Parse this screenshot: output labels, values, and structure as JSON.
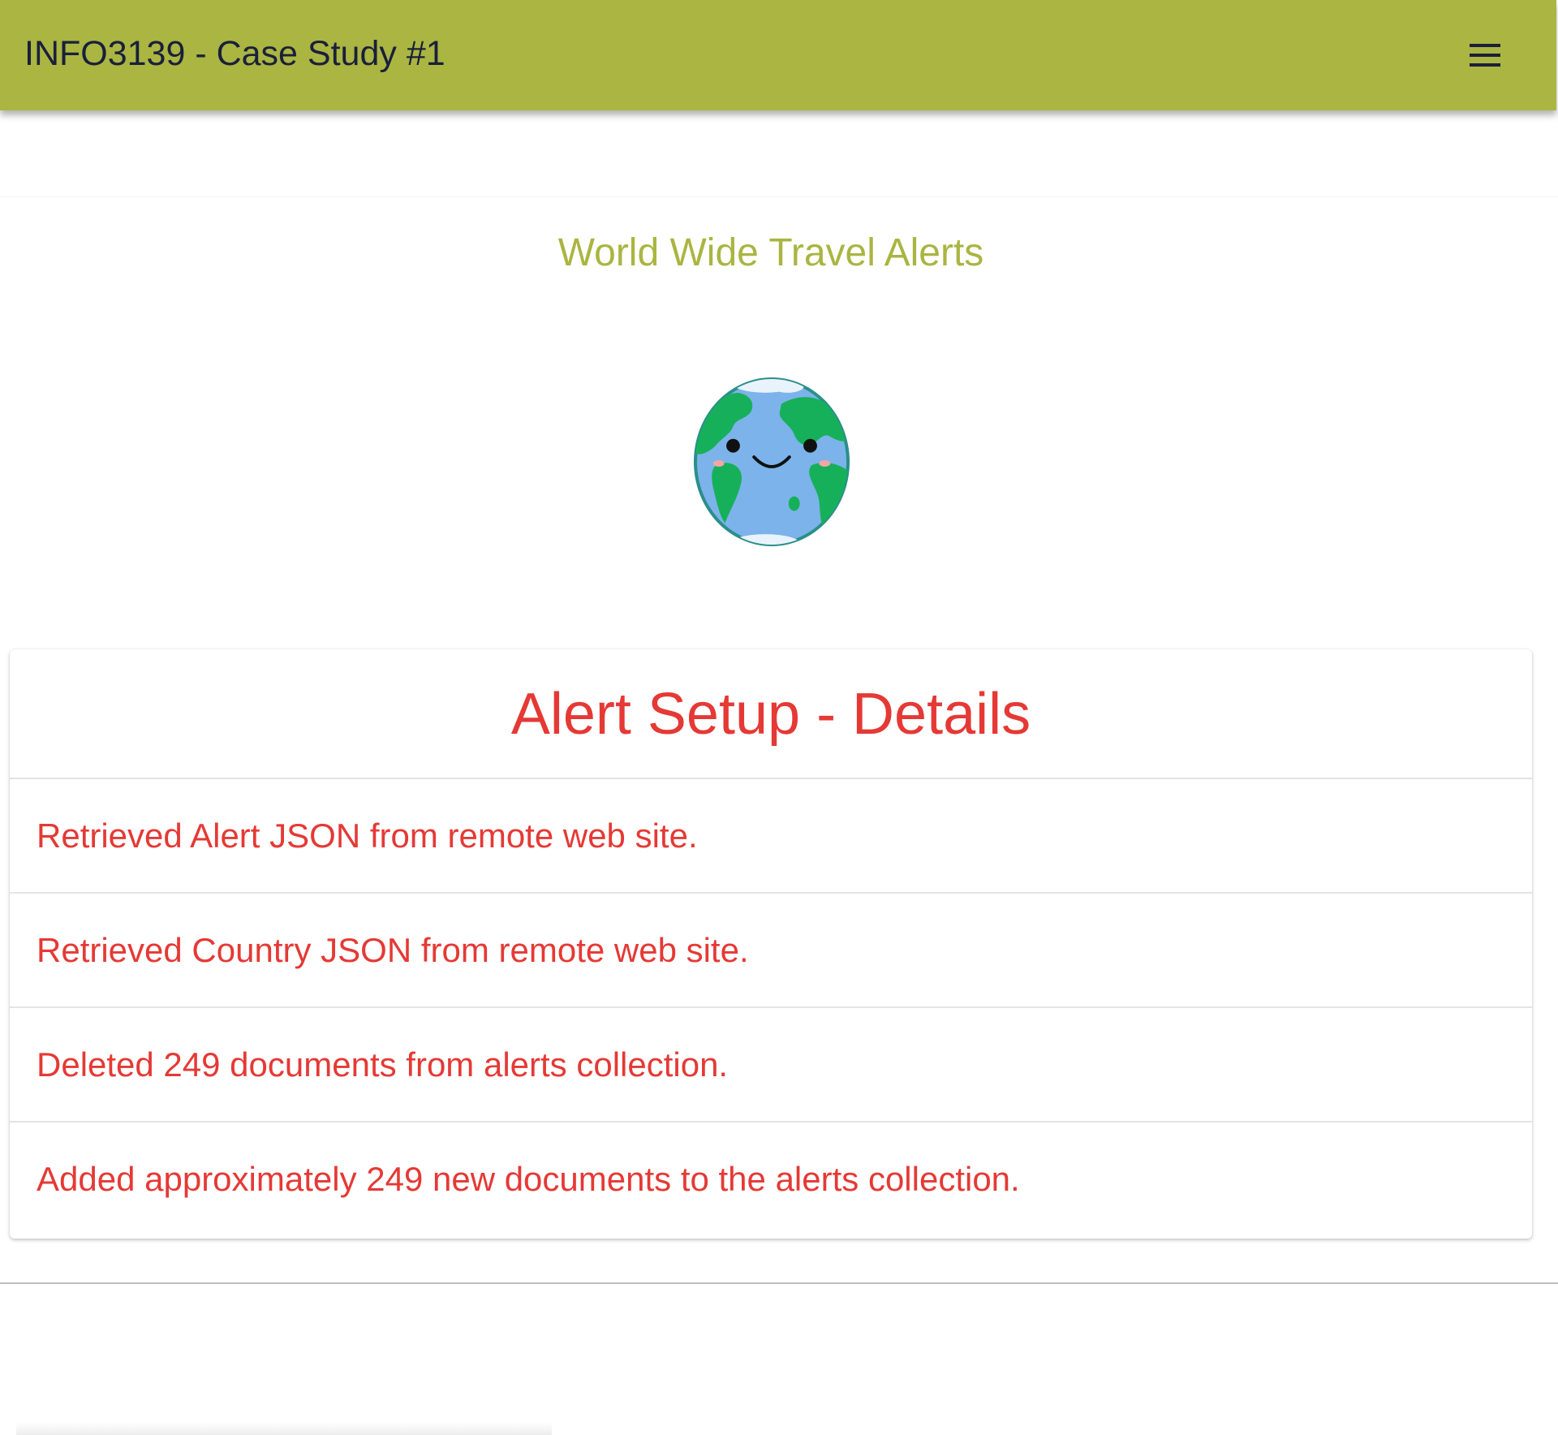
{
  "header": {
    "title": "INFO3139 - Case Study #1",
    "menu_icon": "hamburger-menu-icon",
    "background_color": "#aab542",
    "title_color": "#1a1f3a"
  },
  "main": {
    "subtitle": "World Wide Travel Alerts",
    "subtitle_color": "#aab542",
    "logo_icon": "smiling-globe-icon"
  },
  "card": {
    "title": "Alert Setup - Details",
    "text_color": "#e53935",
    "items": [
      "Retrieved Alert JSON from remote web site.",
      "Retrieved Country JSON from remote web site.",
      "Deleted 249 documents from alerts collection.",
      "Added approximately 249 new documents to the alerts collection."
    ]
  }
}
